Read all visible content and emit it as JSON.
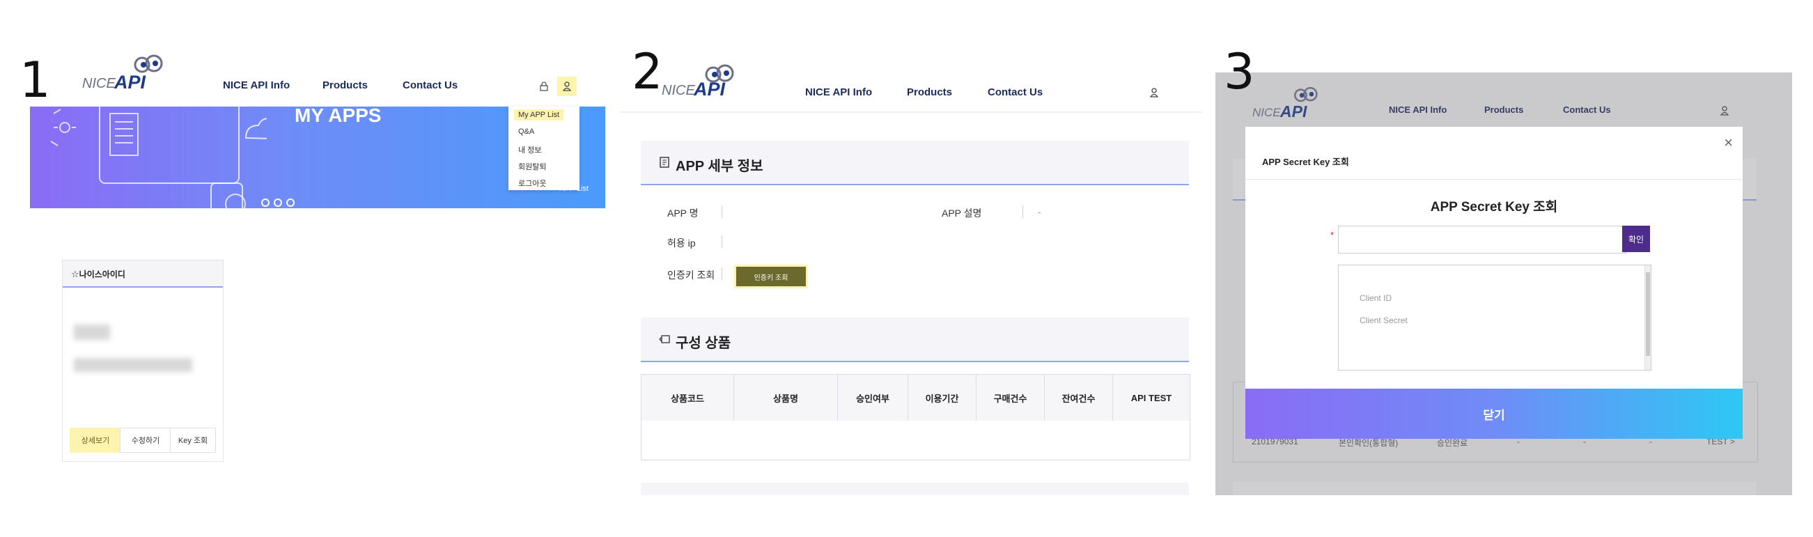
{
  "panel1": {
    "step": "1",
    "logo": {
      "nice": "NICE",
      "api": "API"
    },
    "nav": [
      "NICE API Info",
      "Products",
      "Contact Us"
    ],
    "banner_title": "MY APPS",
    "dropdown": [
      "My APP List",
      "Q&A",
      "내 정보",
      "회원탈퇴",
      "로그아웃"
    ],
    "banner_crumb": "APP List",
    "card": {
      "title": "나이스아이디",
      "buttons": [
        "상세보기",
        "수정하기",
        "Key 조회"
      ]
    }
  },
  "panel2": {
    "step": "2",
    "logo": {
      "nice": "NICE",
      "api": "API"
    },
    "nav": [
      "NICE API Info",
      "Products",
      "Contact Us"
    ],
    "section1_title": "APP 세부 정보",
    "fields": {
      "app_name": "APP 명",
      "app_desc": "APP 설명",
      "allow_ip": "허용 ip",
      "auth_key": "인증키 조회",
      "desc_value": "-"
    },
    "verify_button": "인증키 조회",
    "section2_title": "구성 상품",
    "table_headers": [
      "상품코드",
      "상품명",
      "승인여부",
      "이용기간",
      "구매건수",
      "잔여건수",
      "API TEST"
    ]
  },
  "panel3": {
    "step": "3",
    "logo": {
      "nice": "NICE",
      "api": "API"
    },
    "nav": [
      "NICE API Info",
      "Products",
      "Contact Us"
    ],
    "modal_small_title": "APP Secret Key 조회",
    "modal_title": "APP Secret Key 조회",
    "required_mark": "*",
    "confirm_button": "확인",
    "result_labels": [
      "Client ID",
      "Client Secret"
    ],
    "close_button": "닫기",
    "background_row": {
      "code": "2101979031",
      "name": "본인확인(통합형)",
      "status": "승인완료",
      "dash": "-",
      "test": "TEST >"
    }
  },
  "colors": {
    "brand_navy": "#1b2a5e",
    "accent_purple": "#4e2c8e",
    "highlight_yellow": "#fff3b0"
  }
}
